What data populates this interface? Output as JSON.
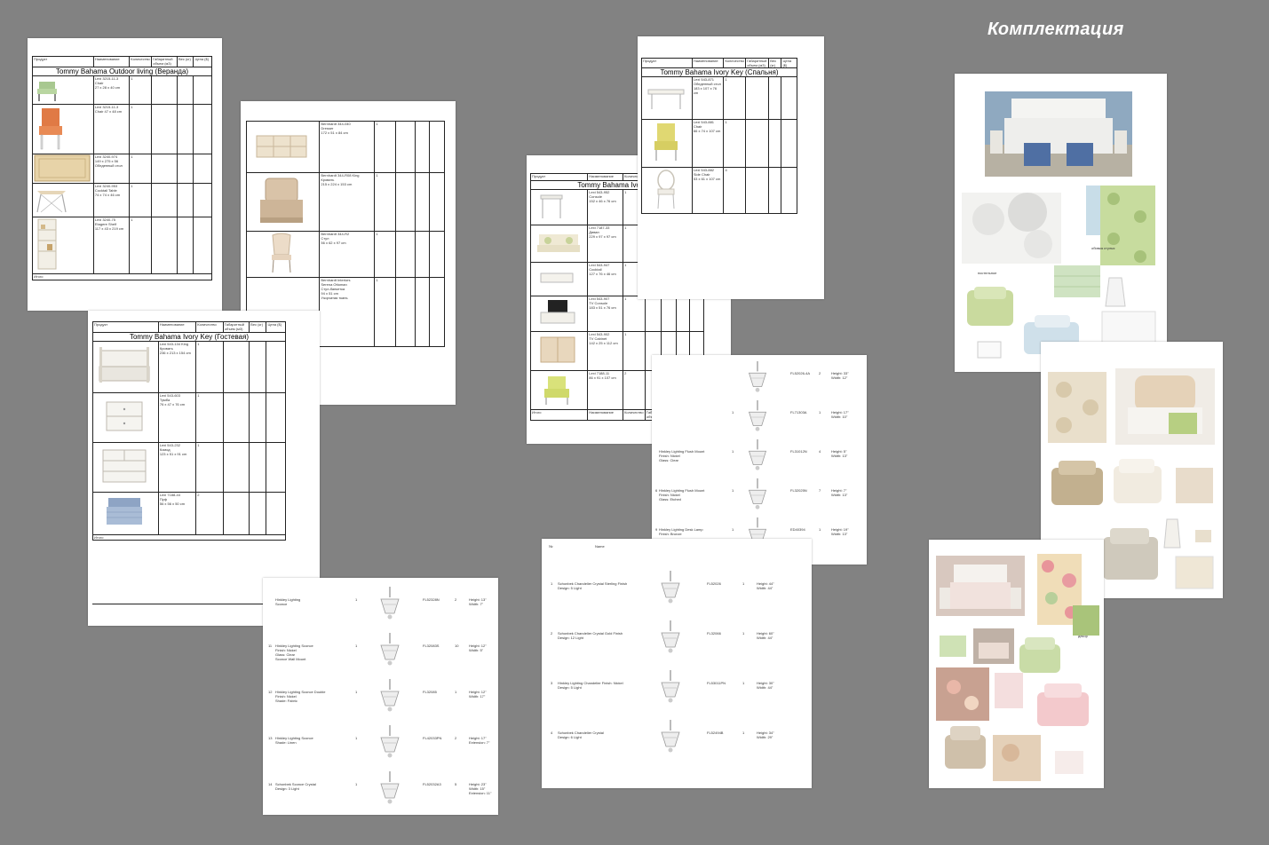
{
  "title": "Комплектация",
  "sheet1": {
    "headers": [
      "Продукт",
      "Наименование",
      "Количество",
      "Габаритный объем (м3)",
      "Вес (кг)",
      "Цена ($)"
    ],
    "section": "Tommy Bahama Outdoor living (Веранда)",
    "rows": [
      {
        "desc": "Lexi 3215-11-3\nChair\n27 x 28 x 40 cm",
        "qty": "1"
      },
      {
        "desc": "Lexi 3215-11-3\nChair 47 x 48 cm",
        "qty": "1"
      },
      {
        "desc": "Lexi 3240-974\n149 x 275 х 56\nОбеденный стол",
        "qty": "1"
      },
      {
        "desc": "Lexi 3240-953\nCocktail Table\n74 x 74 x 46 cm",
        "qty": "1"
      },
      {
        "desc": "Lexi 3240-75\nEtagere Shelf\n117 x 43 x 219 cm",
        "qty": "1"
      }
    ],
    "footer": "Итого"
  },
  "sheet2": {
    "rows": [
      {
        "desc": "Bernhardt 344-040\nDresser\n172 x 51 x 84 cm",
        "qty": "1"
      },
      {
        "desc": "Bernhardt 344-R08 King\nКровать\n215 x 224 x 153 cm",
        "qty": "1"
      },
      {
        "desc": "Bernhardt 344-R2\nСтул\n56 x 62 x 97 cm",
        "qty": "1"
      },
      {
        "desc": "Bernhardt Interiors\nSerena Ottoman\nСтул-банкетка\n94 x 51 cm\nУзорчатая ткань",
        "qty": "1"
      }
    ]
  },
  "sheet3": {
    "headers": [
      "Продукт",
      "Наименование",
      "Количество",
      "Габаритный объем (м3)",
      "Вес (кг)",
      "Цена ($)"
    ],
    "section": "Tommy Bahama Ivory Key (Гостевая)",
    "rows": [
      {
        "desc": "Lexi 543-134 King\nКровать\n236 x 213 x 154 cm",
        "qty": "1"
      },
      {
        "desc": "Lexi 543-603\nТумба\n76 x 47 x 76 cm",
        "qty": "1"
      },
      {
        "desc": "Lexi 543-232\nКомод\n123 x 51 x 91 cm",
        "qty": "1"
      },
      {
        "desc": "Lexi 7188-44\nПуф\n56 x 56 x 50 cm",
        "qty": "2"
      }
    ],
    "footer": "Итого"
  },
  "sheet4": {
    "headers": [
      "Продукт",
      "Наименование",
      "Количество",
      "Габаритный объем (м3)",
      "Вес (кг)",
      "Цена ($)"
    ],
    "section": "Tommy Bahama Ivory Key (Спальня)",
    "rows": [
      {
        "desc": "Lexi 543-871\nОбеденный стол\n183 x 107 x 76 cm",
        "qty": "1"
      },
      {
        "desc": "Lexi 543-881\nChair\n66 x 74 x 107 cm",
        "qty": "1"
      },
      {
        "desc": "Lexi 543-882\nSide Chair\n53 x 61 x 107 cm",
        "qty": "4"
      }
    ]
  },
  "sheet5": {
    "headers": [
      "Продукт",
      "Наименование",
      "Количество"
    ],
    "section": "Tommy Bahama Ivory Ke",
    "rows": [
      {
        "desc": "Lexi 543-952\nConsole\n152 x 46 x 76 cm",
        "qty": "1"
      },
      {
        "desc": "Lexi 7187-33\nДиван\n229 x 97 x 97 cm",
        "qty": "1"
      },
      {
        "desc": "Lexi 543-947\nCocktail\n127 x 76 x 46 cm",
        "qty": "1"
      },
      {
        "desc": "Lexi 543-907\nTV Console\n183 x 51 x 76 cm",
        "qty": "1"
      },
      {
        "desc": "Lexi 543-902\nTV Cabinet\n142 x 25 x 112 cm",
        "qty": "1"
      },
      {
        "desc": "Lexi 7188-11\n86 x 91 x 107 cm",
        "qty": "2"
      }
    ],
    "footer": [
      "Итого",
      "Наименование",
      "Количество",
      "Габаритный объем",
      "Вес"
    ]
  },
  "lights_top": {
    "rows": [
      {
        "num": "",
        "desc": "",
        "qty": "",
        "code": "FL52026-4A",
        "cnt": "2",
        "dims": "Height: 33\"\nWidth: 12\""
      },
      {
        "num": "",
        "desc": "",
        "qty": "1",
        "code": "FL71303A",
        "cnt": "1",
        "dims": "Height: 17\"\nWidth: 10\""
      },
      {
        "num": "",
        "desc": "Hinkley Lighting Flush Mount\nFinish: Nickel\nGlass: Clear",
        "qty": "1",
        "code": "FL31012N",
        "cnt": "4",
        "dims": "Height: 5\"\nWidth: 13\""
      },
      {
        "num": "6",
        "desc": "Hinkley Lighting Flush Mount\nFinish: Nickel\nGlass: Etched",
        "qty": "1",
        "code": "FL32025N",
        "cnt": "7",
        "dims": "Height: 7\"\nWidth: 13\""
      },
      {
        "num": "9",
        "desc": "Hinkley Lighting Desk Lamp\nFinish: Bronze",
        "qty": "1",
        "code": "ED40394",
        "cnt": "1",
        "dims": "Height: 19\"\nWidth: 13\""
      }
    ]
  },
  "lights_bottom": {
    "headers": [
      "№",
      "Name"
    ],
    "rows": [
      {
        "num": "1",
        "desc": "Schonbek Chandelier Crystal Sterling Finish\nDesign: 5 Light",
        "code": "FL52026",
        "cnt": "1",
        "dims": "Height: 44\"\nWidth: 44\""
      },
      {
        "num": "2",
        "desc": "Schonbek Chandelier Crystal Gold Finish\nDesign: 12 Light",
        "code": "FL32066",
        "cnt": "1",
        "dims": "Height: 60\"\nWidth: 44\""
      },
      {
        "num": "3",
        "desc": "Hinkley Lighting Chandelier Finish: Nickel\nDesign: 5 Light",
        "code": "FL53011PN",
        "cnt": "1",
        "dims": "Height: 30\"\nWidth: 44\""
      },
      {
        "num": "4",
        "desc": "Schonbek Chandelier Crystal\nDesign: 6 Light",
        "code": "FL52494B",
        "cnt": "1",
        "dims": "Height: 34\"\nWidth: 29\""
      }
    ]
  },
  "lights_left": {
    "rows": [
      {
        "num": "",
        "desc": "Hinkley Lighting\nSconce",
        "qty": "1",
        "code": "FL52328N",
        "cnt": "2",
        "dims": "Height: 13\"\nWidth: 7\""
      },
      {
        "num": "11",
        "desc": "Hinkley Lighting Sconce\nFinish: Nickel\nGlass: Clear\nSconce Wall Mount",
        "qty": "1",
        "code": "FL32083S",
        "cnt": "10",
        "dims": "Height: 12\"\nWidth: 5\""
      },
      {
        "num": "12",
        "desc": "Hinkley Lighting Sconce Double\nFinish: Nickel\nShade: Fabric",
        "qty": "1",
        "code": "FL32085",
        "cnt": "1",
        "dims": "Height: 12\"\nWidth: 17\""
      },
      {
        "num": "13",
        "desc": "Hinkley Lighting Sconce\nShade: Linen",
        "qty": "1",
        "code": "FL42033PN",
        "cnt": "2",
        "dims": "Height: 17\"\nExtension: 7\""
      },
      {
        "num": "14",
        "desc": "Schonbek Sconce Crystal\nDesign: 3 Light",
        "qty": "1",
        "code": "FL52032A3",
        "cnt": "5",
        "dims": "Height: 23\"\nWidth: 15\"\nExtension: 11\""
      }
    ]
  },
  "mood1": {
    "labels": [
      "постельное",
      "обивка стулья"
    ]
  },
  "mood1_lower": {
    "labels": [
      "постельное",
      "постельное комплект"
    ]
  },
  "mood3": {
    "labels": [
      "декор"
    ]
  },
  "colors": {
    "background": "#828282",
    "paper": "#ffffff",
    "title": "#ffffff"
  }
}
